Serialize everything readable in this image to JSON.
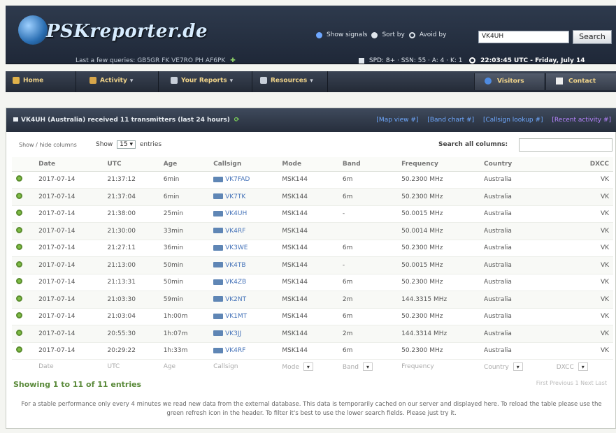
{
  "header": {
    "logo": "PSKreporter.de",
    "last_queries_label": "Last a few queries:",
    "last_queries_calls": "GB5GR FK VE7RO PH AF6PK",
    "signal_options": {
      "show_signals": "Show signals",
      "sort_by": "Sort by",
      "avoid_by": "Avoid by"
    },
    "search_value": "VK4UH",
    "search_button": "Search",
    "stats": "SPD: 8+ · SSN: 55 · A: 4 · K: 1",
    "clock": "22:03:45 UTC - Friday, July 14"
  },
  "nav": {
    "home": "Home",
    "activity": "Activity",
    "your_reports": "Your Reports",
    "resources": "Resources",
    "visitors": "Visitors",
    "contact": "Contact"
  },
  "panel": {
    "title": "VK4UH (Australia) received 11 transmitters (last 24 hours)",
    "links": [
      "[Map view #]",
      "[Band chart #]",
      "[Callsign lookup #]",
      "[Recent activity #]"
    ],
    "show_hide": "Show / hide columns",
    "show_label": "Show",
    "entries_value": "15",
    "entries_label": "entries",
    "search_all_label": "Search all columns:",
    "columns": [
      "",
      "Date",
      "UTC",
      "Age",
      "Callsign",
      "Mode",
      "Band",
      "Frequency",
      "Country",
      "DXCC"
    ],
    "rows": [
      [
        "2017-07-14",
        "21:37:12",
        "6min",
        "VK7FAD",
        "MSK144",
        "6m",
        "50.2300 MHz",
        "Australia",
        "VK"
      ],
      [
        "2017-07-14",
        "21:37:04",
        "6min",
        "VK7TK",
        "MSK144",
        "6m",
        "50.2300 MHz",
        "Australia",
        "VK"
      ],
      [
        "2017-07-14",
        "21:38:00",
        "25min",
        "VK4UH",
        "MSK144",
        "-",
        "50.0015 MHz",
        "Australia",
        "VK"
      ],
      [
        "2017-07-14",
        "21:30:00",
        "33min",
        "VK4RF",
        "MSK144",
        "",
        "50.0014 MHz",
        "Australia",
        "VK"
      ],
      [
        "2017-07-14",
        "21:27:11",
        "36min",
        "VK3WE",
        "MSK144",
        "6m",
        "50.2300 MHz",
        "Australia",
        "VK"
      ],
      [
        "2017-07-14",
        "21:13:00",
        "50min",
        "VK4TB",
        "MSK144",
        "-",
        "50.0015 MHz",
        "Australia",
        "VK"
      ],
      [
        "2017-07-14",
        "21:13:31",
        "50min",
        "VK4ZB",
        "MSK144",
        "6m",
        "50.2300 MHz",
        "Australia",
        "VK"
      ],
      [
        "2017-07-14",
        "21:03:30",
        "59min",
        "VK2NT",
        "MSK144",
        "2m",
        "144.3315 MHz",
        "Australia",
        "VK"
      ],
      [
        "2017-07-14",
        "21:03:04",
        "1h:00m",
        "VK1MT",
        "MSK144",
        "6m",
        "50.2300 MHz",
        "Australia",
        "VK"
      ],
      [
        "2017-07-14",
        "20:55:30",
        "1h:07m",
        "VK3JJ",
        "MSK144",
        "2m",
        "144.3314 MHz",
        "Australia",
        "VK"
      ],
      [
        "2017-07-14",
        "20:29:22",
        "1h:33m",
        "VK4RF",
        "MSK144",
        "6m",
        "50.2300 MHz",
        "Australia",
        "VK"
      ]
    ],
    "footer_filters": [
      "Date",
      "UTC",
      "Age",
      "Callsign",
      "Mode",
      "Band",
      "Frequency",
      "Country",
      "DXCC"
    ],
    "showing": "Showing 1 to 11 of 11 entries",
    "pager": "First   Previous   1   Next   Last",
    "notice": "For a stable performance only every 4 minutes we read new data from the external database. This data is temporarily cached on our server and displayed here. To reload the table please use the green refresh icon in the header. To filter it's best to use the lower search fields. Please just try it."
  },
  "colors": {
    "header_bg": "#26303f",
    "accent_green": "#5a8a3a",
    "nav_text": "#f2d58a",
    "link_blue": "#6fa9ff",
    "link_purple": "#b784ff"
  }
}
